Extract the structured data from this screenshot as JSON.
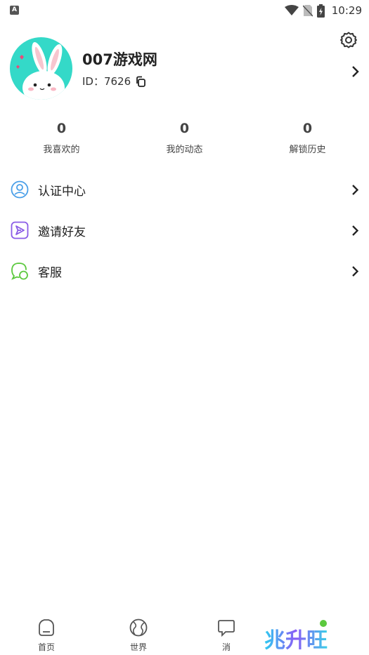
{
  "status_bar": {
    "time": "10:29",
    "left_icon": "A"
  },
  "profile": {
    "name": "007游戏网",
    "id_text": "ID：7626"
  },
  "stats": [
    {
      "value": "0",
      "label": "我喜欢的"
    },
    {
      "value": "0",
      "label": "我的动态"
    },
    {
      "value": "0",
      "label": "解锁历史"
    }
  ],
  "menu": [
    {
      "label": "认证中心",
      "icon": "user-circle-icon",
      "color": "#4a9fe8"
    },
    {
      "label": "邀请好友",
      "icon": "send-icon",
      "color": "#8a5ce6"
    },
    {
      "label": "客服",
      "icon": "chat-bubble-icon",
      "color": "#5cc93e"
    }
  ],
  "tabs": [
    {
      "label": "首页",
      "icon": "home-icon"
    },
    {
      "label": "世界",
      "icon": "globe-icon"
    },
    {
      "label": "消",
      "icon": "message-icon"
    }
  ],
  "watermark": "兆升旺"
}
